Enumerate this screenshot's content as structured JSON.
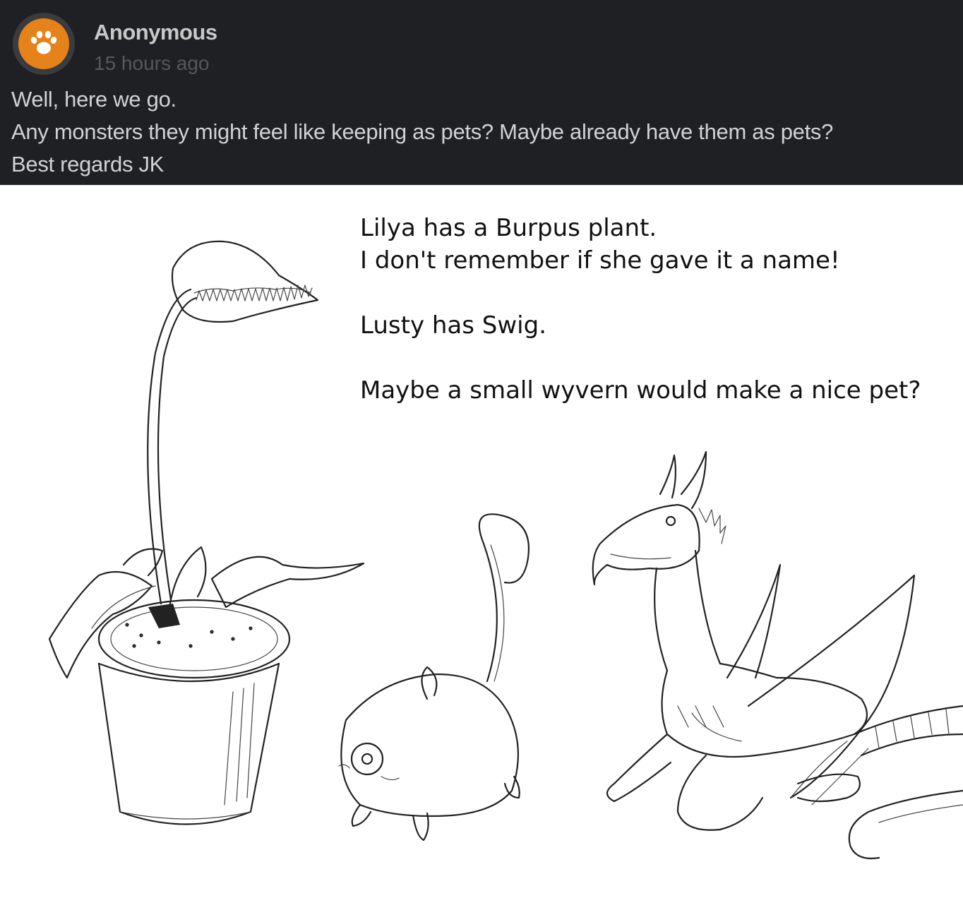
{
  "comment": {
    "author": "Anonymous",
    "timestamp": "15 hours ago",
    "avatar_icon": "paw-icon",
    "avatar_color": "#e58219",
    "lines": [
      "Well, here we go.",
      "Any monsters they might feel like keeping as pets? Maybe already have them as pets?",
      "Best regards JK"
    ]
  },
  "reply": {
    "paragraph1": [
      "Lilya has a Burpus plant.",
      "I don't remember if she gave it a name!"
    ],
    "paragraph2": "Lusty has Swig.",
    "paragraph3": "Maybe a small wyvern would make a nice pet?"
  },
  "illustration": {
    "subjects": [
      "burpus-plant",
      "swig",
      "wyvern"
    ]
  }
}
